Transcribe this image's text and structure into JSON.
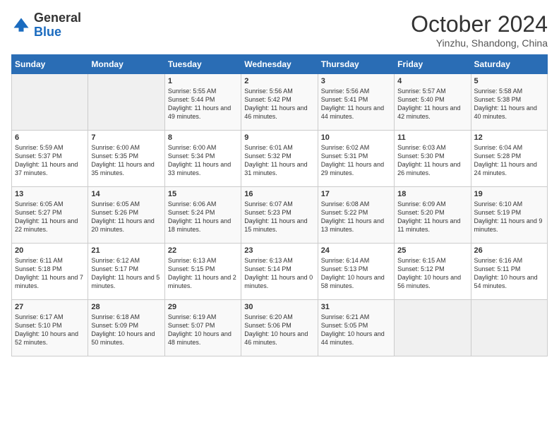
{
  "logo": {
    "general": "General",
    "blue": "Blue"
  },
  "header": {
    "month": "October 2024",
    "location": "Yinzhu, Shandong, China"
  },
  "days_of_week": [
    "Sunday",
    "Monday",
    "Tuesday",
    "Wednesday",
    "Thursday",
    "Friday",
    "Saturday"
  ],
  "weeks": [
    [
      {
        "day": "",
        "sunrise": "",
        "sunset": "",
        "daylight": ""
      },
      {
        "day": "",
        "sunrise": "",
        "sunset": "",
        "daylight": ""
      },
      {
        "day": "1",
        "sunrise": "Sunrise: 5:55 AM",
        "sunset": "Sunset: 5:44 PM",
        "daylight": "Daylight: 11 hours and 49 minutes."
      },
      {
        "day": "2",
        "sunrise": "Sunrise: 5:56 AM",
        "sunset": "Sunset: 5:42 PM",
        "daylight": "Daylight: 11 hours and 46 minutes."
      },
      {
        "day": "3",
        "sunrise": "Sunrise: 5:56 AM",
        "sunset": "Sunset: 5:41 PM",
        "daylight": "Daylight: 11 hours and 44 minutes."
      },
      {
        "day": "4",
        "sunrise": "Sunrise: 5:57 AM",
        "sunset": "Sunset: 5:40 PM",
        "daylight": "Daylight: 11 hours and 42 minutes."
      },
      {
        "day": "5",
        "sunrise": "Sunrise: 5:58 AM",
        "sunset": "Sunset: 5:38 PM",
        "daylight": "Daylight: 11 hours and 40 minutes."
      }
    ],
    [
      {
        "day": "6",
        "sunrise": "Sunrise: 5:59 AM",
        "sunset": "Sunset: 5:37 PM",
        "daylight": "Daylight: 11 hours and 37 minutes."
      },
      {
        "day": "7",
        "sunrise": "Sunrise: 6:00 AM",
        "sunset": "Sunset: 5:35 PM",
        "daylight": "Daylight: 11 hours and 35 minutes."
      },
      {
        "day": "8",
        "sunrise": "Sunrise: 6:00 AM",
        "sunset": "Sunset: 5:34 PM",
        "daylight": "Daylight: 11 hours and 33 minutes."
      },
      {
        "day": "9",
        "sunrise": "Sunrise: 6:01 AM",
        "sunset": "Sunset: 5:32 PM",
        "daylight": "Daylight: 11 hours and 31 minutes."
      },
      {
        "day": "10",
        "sunrise": "Sunrise: 6:02 AM",
        "sunset": "Sunset: 5:31 PM",
        "daylight": "Daylight: 11 hours and 29 minutes."
      },
      {
        "day": "11",
        "sunrise": "Sunrise: 6:03 AM",
        "sunset": "Sunset: 5:30 PM",
        "daylight": "Daylight: 11 hours and 26 minutes."
      },
      {
        "day": "12",
        "sunrise": "Sunrise: 6:04 AM",
        "sunset": "Sunset: 5:28 PM",
        "daylight": "Daylight: 11 hours and 24 minutes."
      }
    ],
    [
      {
        "day": "13",
        "sunrise": "Sunrise: 6:05 AM",
        "sunset": "Sunset: 5:27 PM",
        "daylight": "Daylight: 11 hours and 22 minutes."
      },
      {
        "day": "14",
        "sunrise": "Sunrise: 6:05 AM",
        "sunset": "Sunset: 5:26 PM",
        "daylight": "Daylight: 11 hours and 20 minutes."
      },
      {
        "day": "15",
        "sunrise": "Sunrise: 6:06 AM",
        "sunset": "Sunset: 5:24 PM",
        "daylight": "Daylight: 11 hours and 18 minutes."
      },
      {
        "day": "16",
        "sunrise": "Sunrise: 6:07 AM",
        "sunset": "Sunset: 5:23 PM",
        "daylight": "Daylight: 11 hours and 15 minutes."
      },
      {
        "day": "17",
        "sunrise": "Sunrise: 6:08 AM",
        "sunset": "Sunset: 5:22 PM",
        "daylight": "Daylight: 11 hours and 13 minutes."
      },
      {
        "day": "18",
        "sunrise": "Sunrise: 6:09 AM",
        "sunset": "Sunset: 5:20 PM",
        "daylight": "Daylight: 11 hours and 11 minutes."
      },
      {
        "day": "19",
        "sunrise": "Sunrise: 6:10 AM",
        "sunset": "Sunset: 5:19 PM",
        "daylight": "Daylight: 11 hours and 9 minutes."
      }
    ],
    [
      {
        "day": "20",
        "sunrise": "Sunrise: 6:11 AM",
        "sunset": "Sunset: 5:18 PM",
        "daylight": "Daylight: 11 hours and 7 minutes."
      },
      {
        "day": "21",
        "sunrise": "Sunrise: 6:12 AM",
        "sunset": "Sunset: 5:17 PM",
        "daylight": "Daylight: 11 hours and 5 minutes."
      },
      {
        "day": "22",
        "sunrise": "Sunrise: 6:13 AM",
        "sunset": "Sunset: 5:15 PM",
        "daylight": "Daylight: 11 hours and 2 minutes."
      },
      {
        "day": "23",
        "sunrise": "Sunrise: 6:13 AM",
        "sunset": "Sunset: 5:14 PM",
        "daylight": "Daylight: 11 hours and 0 minutes."
      },
      {
        "day": "24",
        "sunrise": "Sunrise: 6:14 AM",
        "sunset": "Sunset: 5:13 PM",
        "daylight": "Daylight: 10 hours and 58 minutes."
      },
      {
        "day": "25",
        "sunrise": "Sunrise: 6:15 AM",
        "sunset": "Sunset: 5:12 PM",
        "daylight": "Daylight: 10 hours and 56 minutes."
      },
      {
        "day": "26",
        "sunrise": "Sunrise: 6:16 AM",
        "sunset": "Sunset: 5:11 PM",
        "daylight": "Daylight: 10 hours and 54 minutes."
      }
    ],
    [
      {
        "day": "27",
        "sunrise": "Sunrise: 6:17 AM",
        "sunset": "Sunset: 5:10 PM",
        "daylight": "Daylight: 10 hours and 52 minutes."
      },
      {
        "day": "28",
        "sunrise": "Sunrise: 6:18 AM",
        "sunset": "Sunset: 5:09 PM",
        "daylight": "Daylight: 10 hours and 50 minutes."
      },
      {
        "day": "29",
        "sunrise": "Sunrise: 6:19 AM",
        "sunset": "Sunset: 5:07 PM",
        "daylight": "Daylight: 10 hours and 48 minutes."
      },
      {
        "day": "30",
        "sunrise": "Sunrise: 6:20 AM",
        "sunset": "Sunset: 5:06 PM",
        "daylight": "Daylight: 10 hours and 46 minutes."
      },
      {
        "day": "31",
        "sunrise": "Sunrise: 6:21 AM",
        "sunset": "Sunset: 5:05 PM",
        "daylight": "Daylight: 10 hours and 44 minutes."
      },
      {
        "day": "",
        "sunrise": "",
        "sunset": "",
        "daylight": ""
      },
      {
        "day": "",
        "sunrise": "",
        "sunset": "",
        "daylight": ""
      }
    ]
  ]
}
